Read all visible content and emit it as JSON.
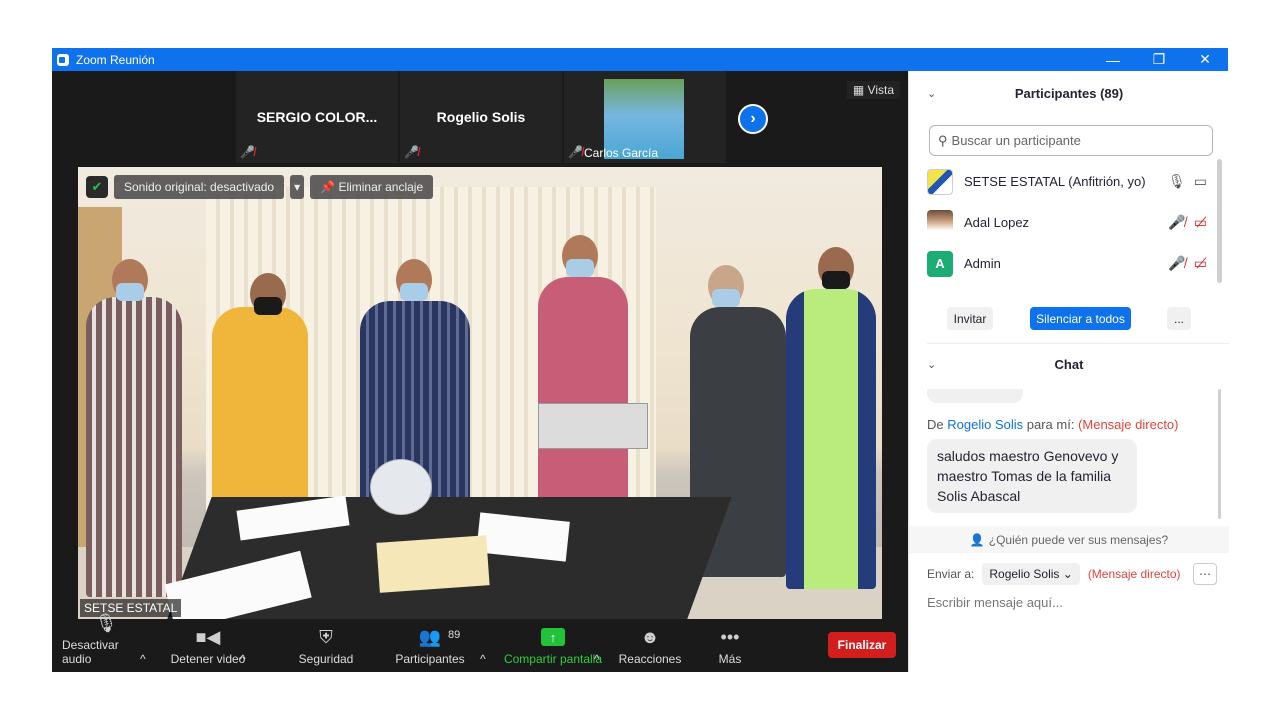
{
  "titlebar": {
    "title": "Zoom Reunión",
    "minimize": "—",
    "restore": "❐",
    "close": "✕"
  },
  "strip": {
    "tiles": [
      {
        "name": "SERGIO  COLOR..."
      },
      {
        "name": "Rogelio Solis"
      },
      {
        "name": "Carlos García"
      }
    ],
    "vista": "Vista"
  },
  "video": {
    "sound_pill": "Sonido original: desactivado",
    "unpin_pill": "Eliminar anclaje",
    "speaker_label": "SETSE ESTATAL"
  },
  "toolbar": {
    "audio": "Desactivar audio",
    "video": "Detener video",
    "security": "Seguridad",
    "participants": "Participantes",
    "participants_count": "89",
    "share": "Compartir pantalla",
    "reactions": "Reacciones",
    "more": "Más",
    "end": "Finalizar"
  },
  "participants_panel": {
    "title": "Participantes (89)",
    "search_placeholder": "Buscar un participante",
    "items": [
      {
        "name": "SETSE ESTATAL (Anfitrión, yo)",
        "avatar_letter": ""
      },
      {
        "name": "Adal Lopez",
        "avatar_letter": ""
      },
      {
        "name": "Admin",
        "avatar_letter": "A"
      }
    ],
    "invite": "Invitar",
    "mute_all": "Silenciar a todos",
    "more": "..."
  },
  "chat": {
    "title": "Chat",
    "from_prefix": "De",
    "from_name": "Rogelio Solis",
    "from_suffix": "para mí:",
    "direct": "(Mensaje directo)",
    "message": "saludos maestro Genovevo y maestro Tomas de la familia Solis Abascal",
    "who_can_see": "¿Quién puede ver sus mensajes?",
    "send_to_label": "Enviar a:",
    "send_to_value": "Rogelio Solis",
    "send_to_direct": "(Mensaje directo)",
    "input_placeholder": "Escribir mensaje aquí..."
  },
  "colors": {
    "zoom_blue": "#0e72ed",
    "end_red": "#d31e1e",
    "share_green": "#22c23a"
  }
}
